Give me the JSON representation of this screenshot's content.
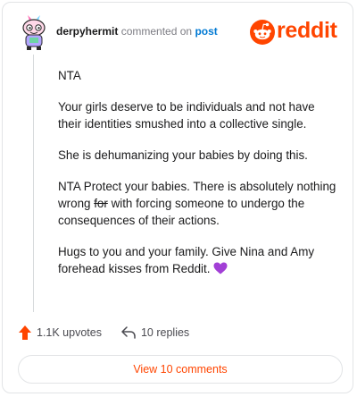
{
  "comment": {
    "username": "derpyhermit",
    "action_text": "commented on",
    "target_link": "post",
    "paragraphs": {
      "p1": "NTA",
      "p2": "Your girls deserve to be individuals and not have their identities smushed into a collective single.",
      "p3": "She is dehumanizing your babies by doing this.",
      "p4_before": "NTA Protect your babies. There is absolutely nothing wrong ",
      "p4_strike": "for",
      "p4_after": " with forcing someone to undergo the consequences of their actions.",
      "p5": "Hugs to you and your family. Give Nina and Amy forehead kisses from Reddit."
    }
  },
  "brand": {
    "wordmark": "reddit",
    "color": "#ff4500"
  },
  "stats": {
    "upvotes": "1.1K upvotes",
    "replies": "10 replies"
  },
  "view_button": "View 10 comments",
  "icons": {
    "upvote": "upvote-arrow-icon",
    "reply": "reply-arrow-icon",
    "heart": "purple-heart-emoji",
    "logo": "reddit-snoo-icon"
  },
  "colors": {
    "upvote": "#ff4500",
    "link": "#0079d3",
    "heart": "#a23fd6",
    "view_text": "#ff4500"
  }
}
